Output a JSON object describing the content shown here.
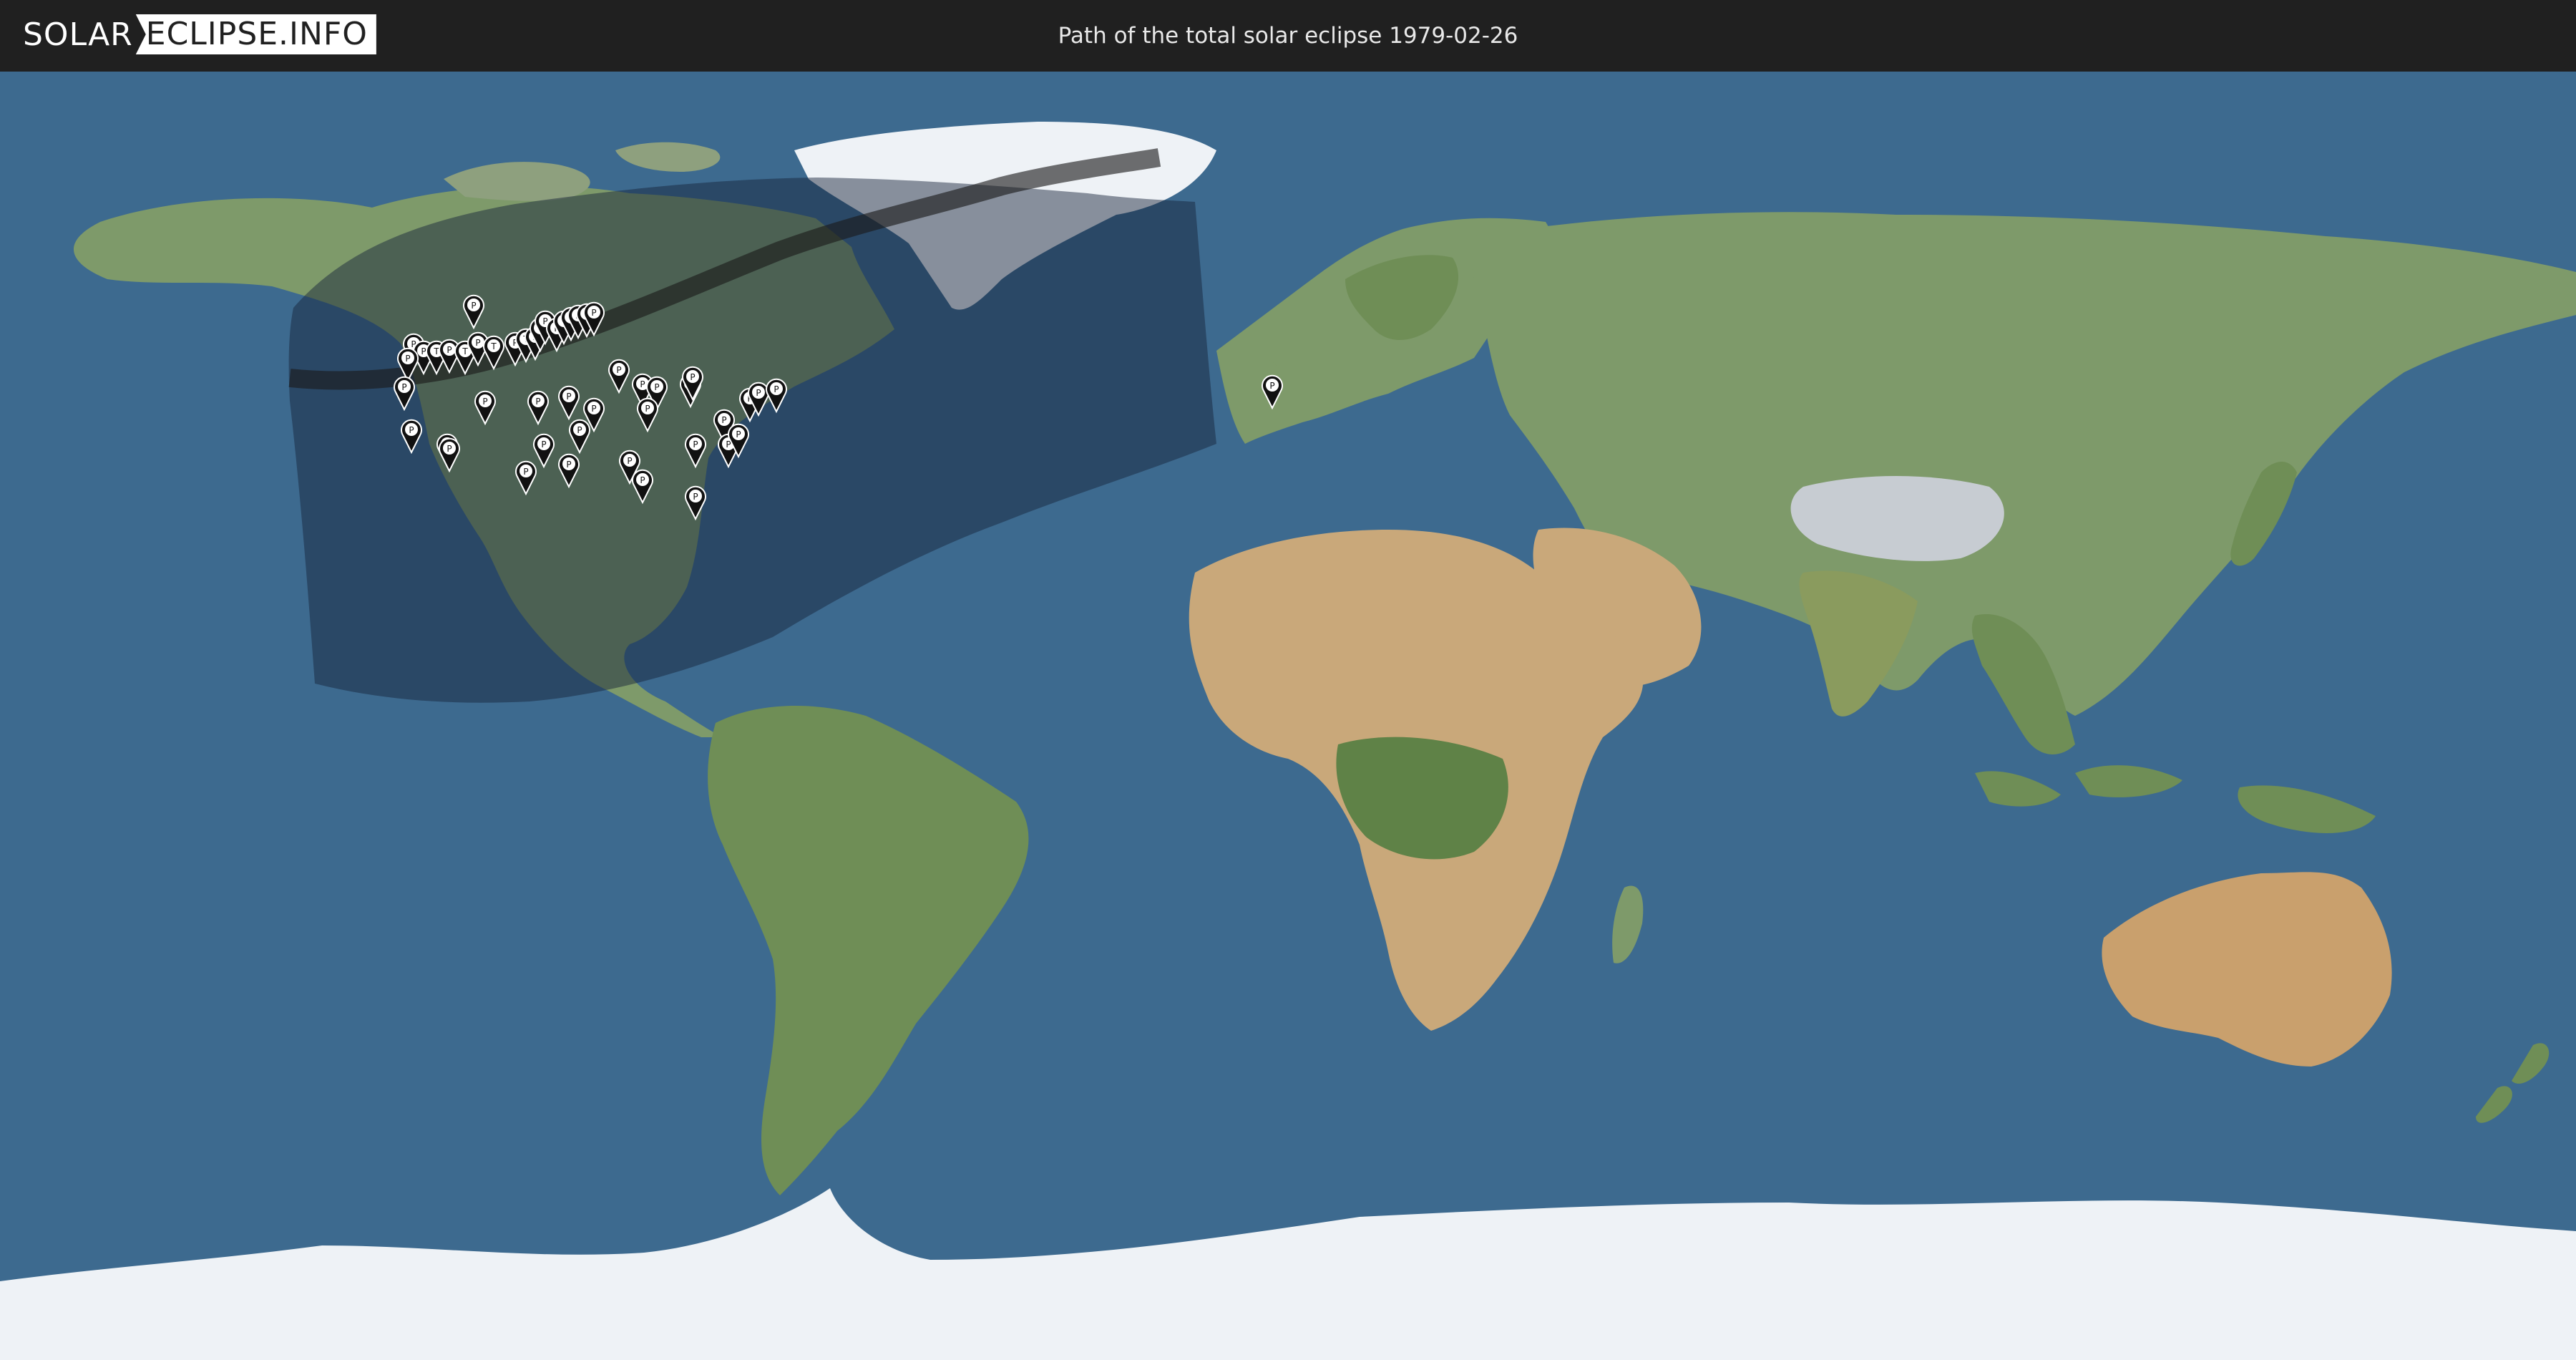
{
  "header": {
    "logo_left": "SOLAR",
    "logo_right": "ECLIPSE.INFO",
    "title": "Path of the total solar eclipse 1979-02-26"
  },
  "map": {
    "ocean_color": "#3d6a8f",
    "land_color": "#7e9a6a",
    "desert_color": "#c9a87a",
    "ice_color": "#eef2f6",
    "penumbra_color": "#16243a",
    "totality_path_color": "#1a1a1a",
    "marker_glyph": "P",
    "markers": [
      {
        "type": "P"
      },
      {
        "type": "P"
      },
      {
        "type": "P"
      },
      {
        "type": "T"
      },
      {
        "type": "P"
      },
      {
        "type": "T"
      },
      {
        "type": "P"
      },
      {
        "type": "T"
      },
      {
        "type": "P"
      },
      {
        "type": "T"
      },
      {
        "type": "P"
      },
      {
        "type": "T"
      },
      {
        "type": "P"
      },
      {
        "type": "P"
      },
      {
        "type": "T"
      },
      {
        "type": "P"
      },
      {
        "type": "P"
      },
      {
        "type": "P"
      },
      {
        "type": "P"
      },
      {
        "type": "P"
      },
      {
        "type": "P"
      },
      {
        "type": "P"
      },
      {
        "type": "P"
      },
      {
        "type": "P"
      },
      {
        "type": "P"
      },
      {
        "type": "P"
      },
      {
        "type": "P"
      },
      {
        "type": "P"
      },
      {
        "type": "P"
      },
      {
        "type": "P"
      },
      {
        "type": "P"
      },
      {
        "type": "P"
      },
      {
        "type": "P"
      },
      {
        "type": "P"
      },
      {
        "type": "P"
      },
      {
        "type": "P"
      },
      {
        "type": "P"
      },
      {
        "type": "P"
      },
      {
        "type": "P"
      },
      {
        "type": "P"
      },
      {
        "type": "P"
      },
      {
        "type": "P"
      },
      {
        "type": "P"
      },
      {
        "type": "P"
      },
      {
        "type": "P"
      },
      {
        "type": "P"
      },
      {
        "type": "P"
      },
      {
        "type": "P"
      }
    ]
  }
}
